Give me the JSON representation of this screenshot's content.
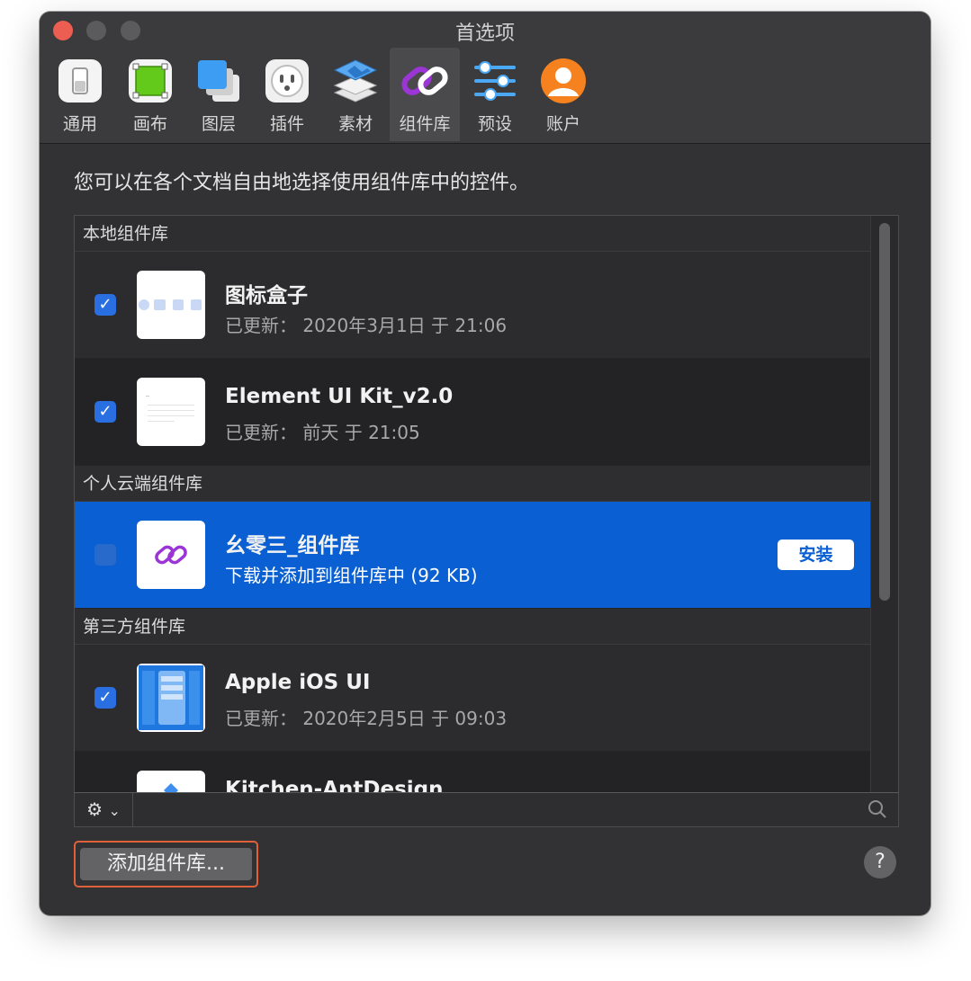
{
  "window": {
    "title": "首选项"
  },
  "toolbar": {
    "items": [
      {
        "label": "通用",
        "icon": "general-switch-icon"
      },
      {
        "label": "画布",
        "icon": "canvas-icon"
      },
      {
        "label": "图层",
        "icon": "layers-icon"
      },
      {
        "label": "插件",
        "icon": "plugin-outlet-icon"
      },
      {
        "label": "素材",
        "icon": "assets-stack-icon"
      },
      {
        "label": "组件库",
        "icon": "library-link-icon"
      },
      {
        "label": "预设",
        "icon": "presets-sliders-icon"
      },
      {
        "label": "账户",
        "icon": "account-avatar-icon"
      }
    ],
    "selected": "组件库"
  },
  "intro": "您可以在各个文档自由地选择使用组件库中的控件。",
  "sections": [
    {
      "title": "本地组件库",
      "rows": [
        {
          "title": "图标盒子",
          "subtitle": "已更新： 2020年3月1日 于 21:06",
          "checked": true
        },
        {
          "title": "Element UI Kit_v2.0",
          "subtitle": "已更新： 前天 于 21:05",
          "checked": true
        }
      ]
    },
    {
      "title": "个人云端组件库",
      "rows": [
        {
          "title": "幺零三_组件库",
          "subtitle": "下载并添加到组件库中 (92 KB)",
          "checked": false,
          "action": "安装"
        }
      ]
    },
    {
      "title": "第三方组件库",
      "rows": [
        {
          "title": "Apple iOS UI",
          "subtitle": "已更新： 2020年2月5日 于 09:03",
          "checked": true
        },
        {
          "title": "Kitchen-AntDesign",
          "subtitle": "",
          "checked": true
        }
      ]
    }
  ],
  "bottom_bar": {
    "gear_label": "⚙",
    "chevron": "⌄"
  },
  "footer": {
    "add_button": "添加组件库...",
    "help": "?"
  },
  "colors": {
    "selection": "#0a5fd3",
    "close": "#ec5e51",
    "focus_ring": "#e0603a"
  }
}
